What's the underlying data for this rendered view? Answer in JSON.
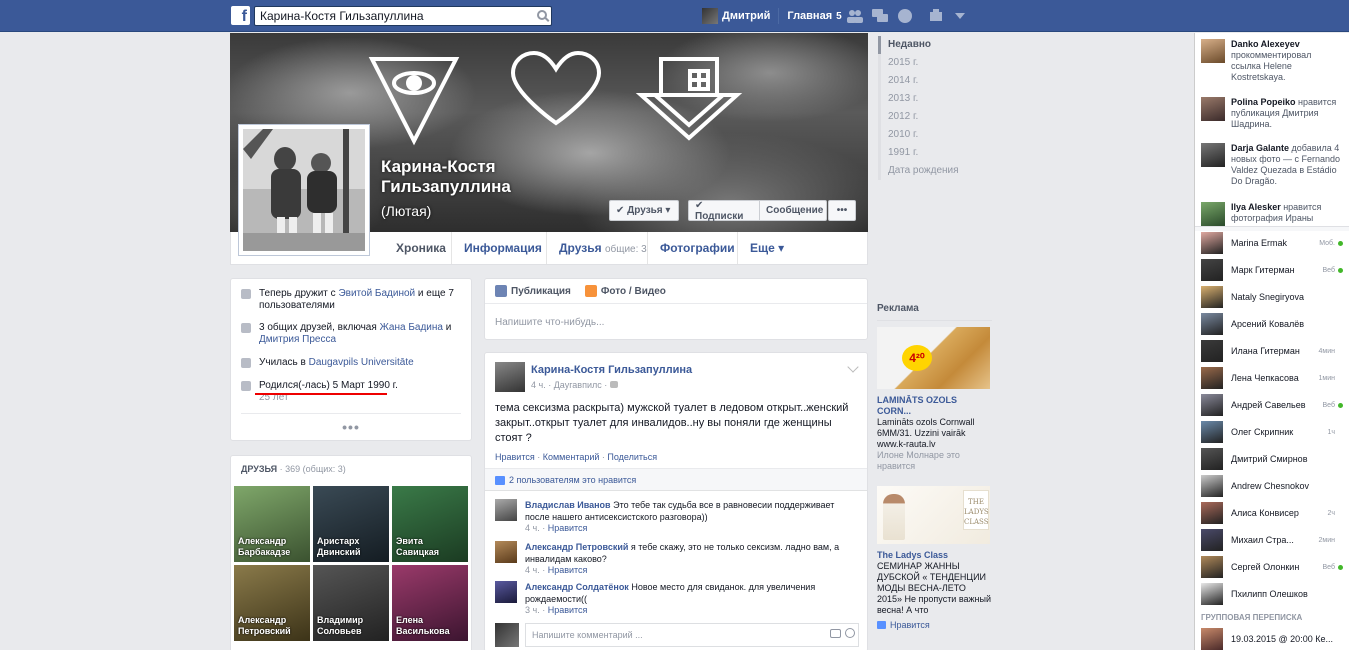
{
  "topbar": {
    "logo": "f",
    "search_value": "Карина-Костя Гильзапуллина",
    "user_name": "Дмитрий",
    "home_label": "Главная",
    "home_count": "5",
    "icons": [
      "friends-icon",
      "messages-icon",
      "globe-icon",
      "privacy-icon",
      "caret-down-icon"
    ]
  },
  "profile": {
    "name": "Карина-Костя Гильзапуллина",
    "nickname": "(Лютая)",
    "buttons": {
      "friends": "✔ Друзья ▾",
      "subscribe": "✔ Подписки",
      "message": "Сообщение",
      "more": "•••"
    }
  },
  "tabs": {
    "timeline": "Хроника",
    "info": "Информация",
    "friends": "Друзья",
    "friends_count": "общие: 3",
    "photos": "Фотографии",
    "more": "Еще ▾"
  },
  "years": [
    "Недавно",
    "2015 г.",
    "2014 г.",
    "2013 г.",
    "2012 г.",
    "2010 г.",
    "1991 г.",
    "Дата рождения"
  ],
  "intro": {
    "item1_pre": "Теперь дружит с ",
    "item1_link": "Эвитой Бадиной",
    "item1_post": " и еще 7 пользователями",
    "item2_pre": "3 общих друзей, включая ",
    "item2_link1": "Жана Бадина",
    "item2_mid": " и ",
    "item2_link2": "Дмитрия Пресса",
    "item3_pre": "Училась в ",
    "item3_link": "Daugavpils Universitāte",
    "item4": "Родился(-лась) 5 Март 1990 г.",
    "item4_sub": "25 лет",
    "dots": "•••"
  },
  "friends_card": {
    "title": "ДРУЗЬЯ",
    "count": " · 369 (общих: 3)",
    "tiles": [
      {
        "name": "Александр Барбакадзе"
      },
      {
        "name": "Аристарх Двинский"
      },
      {
        "name": "Эвита Савицкая"
      },
      {
        "name": "Александр Петровский"
      },
      {
        "name": "Владимир Соловьев"
      },
      {
        "name": "Елена Василькова"
      }
    ]
  },
  "composer": {
    "tab_status": "Публикация",
    "tab_photo": "Фото / Видео",
    "placeholder": "Напишите что-нибудь..."
  },
  "post": {
    "author": "Карина-Костя Гильзапуллина",
    "meta": "4 ч. · Даугавпилс · ",
    "text": "тема сексизма раскрыта) мужской туалет в ледовом открыт..женский закрыт..открыт туалет для инвалидов..ну вы поняли где женщины стоят ?",
    "action_like": "Нравится",
    "action_comment": "Комментарий",
    "action_share": "Поделиться",
    "likes": "2 пользователям это нравится",
    "comments": [
      {
        "author": "Владислав Иванов",
        "text": " Это тебе так судьба все в равновесии поддерживает после нашего антисексистского разговора))",
        "time": "4 ч.",
        "like": "Нравится"
      },
      {
        "author": "Александр Петровский",
        "text": " я тебе скажу, это не только сексизм. ладно вам, а инвалидам каково?",
        "time": "4 ч.",
        "like": "Нравится"
      },
      {
        "author": "Александр Солдатёнок",
        "text": " Новое место для свиданок. для увеличения рождаемости((",
        "time": "3 ч.",
        "like": "Нравится"
      }
    ],
    "comment_placeholder": "Напишите комментарий ..."
  },
  "ads": {
    "title": "Реклама",
    "ad1": {
      "price": "4²⁰",
      "title": "LAMINĀTS OZOLS CORN...",
      "text": "Lamināts ozols Cornwall 6MM/31. Uzzini vairāk www.k-rauta.lv",
      "social": "Илоне Молнаре это нравится"
    },
    "ad2": {
      "sign": "THE LADYS CLASS",
      "title": "The Ladys Class",
      "text": "СЕМИНАР ЖАННЫ ДУБСКОЙ « ТЕНДЕНЦИИ МОДЫ ВЕСНА-ЛЕТО 2015» Не пропусти важный весна! А что",
      "like": "Нравится"
    }
  },
  "ticker": [
    {
      "name": "Danko Alexeyev",
      "text": " прокомментировал ссылка Helene Kostretskaya."
    },
    {
      "name": "Polina Popeiko",
      "text": " нравится публикация Дмитрия Шадрина."
    },
    {
      "name": "Darja Galante",
      "text": " добавила 4 новых фото — с Fernando Valdez Quezada в Estádio Do Dragão."
    },
    {
      "name": "Ilya Alesker",
      "text": " нравится фотография Ираны"
    }
  ],
  "chat": [
    {
      "name": "Marina Ermak",
      "status": "Моб.",
      "online": true,
      "color": "#e0a8a0"
    },
    {
      "name": "Марк Гитерман",
      "status": "Веб",
      "online": true,
      "color": "#444444"
    },
    {
      "name": "Nataly Snegiryova",
      "status": "",
      "online": false,
      "color": "#d9b070"
    },
    {
      "name": "Арсений Ковалёв",
      "status": "",
      "online": false,
      "color": "#7a8aa0"
    },
    {
      "name": "Илана Гитерман",
      "status": "4мин",
      "online": false,
      "color": "#3a3a3a"
    },
    {
      "name": "Лена Чепкасова",
      "status": "1мин",
      "online": false,
      "color": "#9a6a4a"
    },
    {
      "name": "Андрей Савельев",
      "status": "Веб",
      "online": true,
      "color": "#8a8a9a"
    },
    {
      "name": "Олег Скрипник",
      "status": "1ч",
      "online": false,
      "color": "#6a8aaa"
    },
    {
      "name": "Дмитрий Смирнов",
      "status": "",
      "online": false,
      "color": "#555555"
    },
    {
      "name": "Andrew Chesnokov",
      "status": "",
      "online": false,
      "color": "#cccccc"
    },
    {
      "name": "Алиса Конвисер",
      "status": "2ч",
      "online": false,
      "color": "#aa6a5a"
    },
    {
      "name": "Михаил Стра...",
      "status": "2мин",
      "online": false,
      "color": "#4a4a6a"
    },
    {
      "name": "Сергей Олонкин",
      "status": "Веб",
      "online": true,
      "color": "#b08a5a"
    },
    {
      "name": "Пхилипп Олешков",
      "status": "",
      "online": false,
      "color": "#e8e8e8"
    }
  ],
  "chat_group": {
    "title": "ГРУППОВАЯ ПЕРЕПИСКА",
    "item": "19.03.2015 @ 20:00 Ке..."
  },
  "colors": {
    "topbar": "#3b5998",
    "link": "#3b5998",
    "online": "#42b72a",
    "annotation_red": "#ee0000"
  }
}
